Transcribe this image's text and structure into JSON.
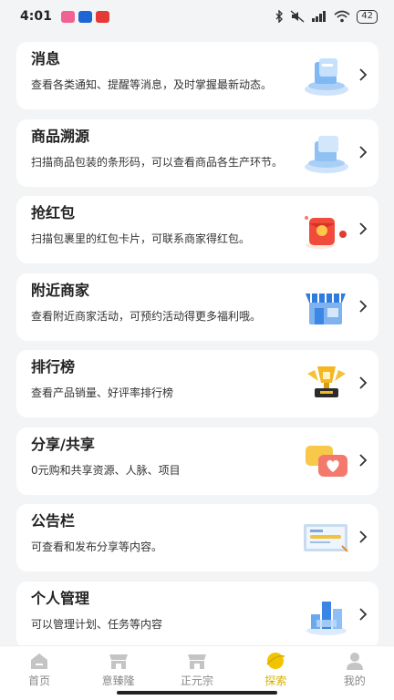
{
  "status": {
    "time": "4:01",
    "battery": "42",
    "app_colors": [
      "#f06292",
      "#1e66d6",
      "#e53935"
    ]
  },
  "items": [
    {
      "title": "消息",
      "desc": "查看各类通知、提醒等消息，及时掌握最新动态。",
      "icon": "message-stack-icon"
    },
    {
      "title": "商品溯源",
      "desc": "扫描商品包装的条形码，可以查看商品各生产环节。",
      "icon": "box-stack-icon"
    },
    {
      "title": "抢红包",
      "desc": "扫描包裹里的红包卡片，可联系商家得红包。",
      "icon": "red-envelope-icon"
    },
    {
      "title": "附近商家",
      "desc": "查看附近商家活动，可预约活动得更多福利哦。",
      "icon": "storefront-icon"
    },
    {
      "title": "排行榜",
      "desc": "查看产品销量、好评率排行榜",
      "icon": "trophy-icon"
    },
    {
      "title": "分享/共享",
      "desc": "0元购和共享资源、人脉、项目",
      "icon": "share-heart-icon"
    },
    {
      "title": "公告栏",
      "desc": "可查看和发布分享等内容。",
      "icon": "bulletin-board-icon"
    },
    {
      "title": "个人管理",
      "desc": "可以管理计划、任务等内容",
      "icon": "chart-blocks-icon"
    }
  ],
  "tabs": [
    {
      "label": "首页",
      "icon": "home-icon",
      "active": false
    },
    {
      "label": "意臻隆",
      "icon": "shop-icon",
      "active": false
    },
    {
      "label": "正元宗",
      "icon": "shop-icon",
      "active": false
    },
    {
      "label": "探索",
      "icon": "explore-icon",
      "active": true
    },
    {
      "label": "我的",
      "icon": "user-icon",
      "active": false
    }
  ],
  "colors": {
    "accent": "#d8b000",
    "inactive_tab": "#888888",
    "card_bg": "#ffffff",
    "page_bg": "#f3f4f6"
  }
}
